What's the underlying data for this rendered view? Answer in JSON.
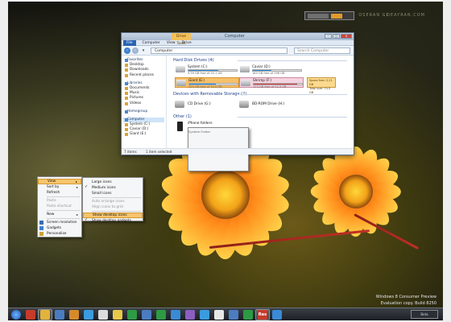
{
  "watermark": {
    "left": "OSERAN GI",
    "right": "DEAYRAN.COM"
  },
  "explorer": {
    "title": "Computer",
    "contextual_tab": "Drive Tools",
    "ribbon_tabs": [
      "File",
      "Computer",
      "View",
      "Drive"
    ],
    "address": "Computer",
    "search_placeholder": "Search Computer",
    "window_buttons": [
      "–",
      "□",
      "x"
    ],
    "nav": [
      {
        "label": "Favorites",
        "type": "head"
      },
      {
        "label": "Desktop",
        "type": "item"
      },
      {
        "label": "Downloads",
        "type": "item"
      },
      {
        "label": "Recent places",
        "type": "item"
      },
      {
        "label": "Libraries",
        "type": "head"
      },
      {
        "label": "Documents",
        "type": "item"
      },
      {
        "label": "Music",
        "type": "item"
      },
      {
        "label": "Pictures",
        "type": "item"
      },
      {
        "label": "Videos",
        "type": "item"
      },
      {
        "label": "Homegroup",
        "type": "head"
      },
      {
        "label": "Computer",
        "type": "head"
      },
      {
        "label": "System (C:)",
        "type": "item"
      },
      {
        "label": "Caviar (D:)",
        "type": "item"
      },
      {
        "label": "Giant (E:)",
        "type": "item"
      }
    ],
    "groups": {
      "hdd": "Hard Disk Drives (4)",
      "removable": "Devices with Removable Storage (2)",
      "other": "Other (1)"
    },
    "drives": [
      {
        "name": "System (C:)",
        "free": "9.59 GB free of 25.1 GB",
        "used_pct": 62,
        "bar_color": "#2a8ad6"
      },
      {
        "name": "Caviar (D:)",
        "free": "183 GB free of 298 GB",
        "used_pct": 38,
        "bar_color": "#2a8ad6"
      },
      {
        "name": "Giant (E:)",
        "free": "325 GB free of 74.5 GB",
        "used_pct": 55,
        "bar_color": "#2a8ad6"
      },
      {
        "name": "Shrimp (F:)",
        "free": "113 GB free of 12.5 GB",
        "used_pct": 90,
        "bar_color": "#d23a3a"
      }
    ],
    "tooltip": [
      "Space free: 2.21 GB",
      "Total size: 74.5 GB"
    ],
    "removable": [
      {
        "name": "CD Drive (G:)"
      },
      {
        "name": "BD-ROM Drive (H:)"
      }
    ],
    "other_items": [
      {
        "name": "iPhone folders",
        "sub": "System Folder"
      }
    ],
    "status": [
      "7 items",
      "1 item selected"
    ]
  },
  "context_menu": {
    "items": [
      {
        "label": "View",
        "arrow": true,
        "state": "highlight"
      },
      {
        "label": "Sort by",
        "arrow": true,
        "state": "normal"
      },
      {
        "label": "Refresh",
        "arrow": false,
        "state": "normal"
      },
      {
        "sep": true
      },
      {
        "label": "Paste",
        "arrow": false,
        "state": "disabled"
      },
      {
        "label": "Paste shortcut",
        "arrow": false,
        "state": "disabled"
      },
      {
        "sep": true
      },
      {
        "label": "New",
        "arrow": true,
        "state": "normal"
      },
      {
        "sep": true
      },
      {
        "label": "Screen resolution",
        "arrow": false,
        "state": "normal"
      },
      {
        "label": "Gadgets",
        "arrow": false,
        "state": "normal"
      },
      {
        "label": "Personalize",
        "arrow": false,
        "state": "normal"
      }
    ]
  },
  "submenu": {
    "items": [
      {
        "label": "Large icons",
        "state": "normal"
      },
      {
        "label": "Medium icons",
        "state": "checked"
      },
      {
        "label": "Small icons",
        "state": "normal"
      },
      {
        "sep": true
      },
      {
        "label": "Auto arrange icons",
        "state": "disabled"
      },
      {
        "label": "Align icons to grid",
        "state": "disabled"
      },
      {
        "sep": true
      },
      {
        "label": "Show desktop icons",
        "state": "highlight"
      },
      {
        "label": "Show desktop gadgets",
        "state": "checked"
      }
    ]
  },
  "version": {
    "line1": "Windows 8 Consumer Preview",
    "line2": "Evaluation copy. Build 8250"
  },
  "taskbar": {
    "tray_label": "Beta",
    "icon_colors": [
      "#c63b2a",
      "#e2b33a",
      "#4b7cc1",
      "#d78a2c",
      "#3a9be0",
      "#dcdcdc",
      "#e8c84a",
      "#2d9a44",
      "#4b7cc1",
      "#2d9a44",
      "#3a8ad6",
      "#8b5ec1",
      "#3a9be0",
      "#e7e7e7",
      "#4b7cc1",
      "#2d9a44",
      "#c53a2a",
      "#3a8ad6"
    ],
    "res_label": "Res"
  }
}
